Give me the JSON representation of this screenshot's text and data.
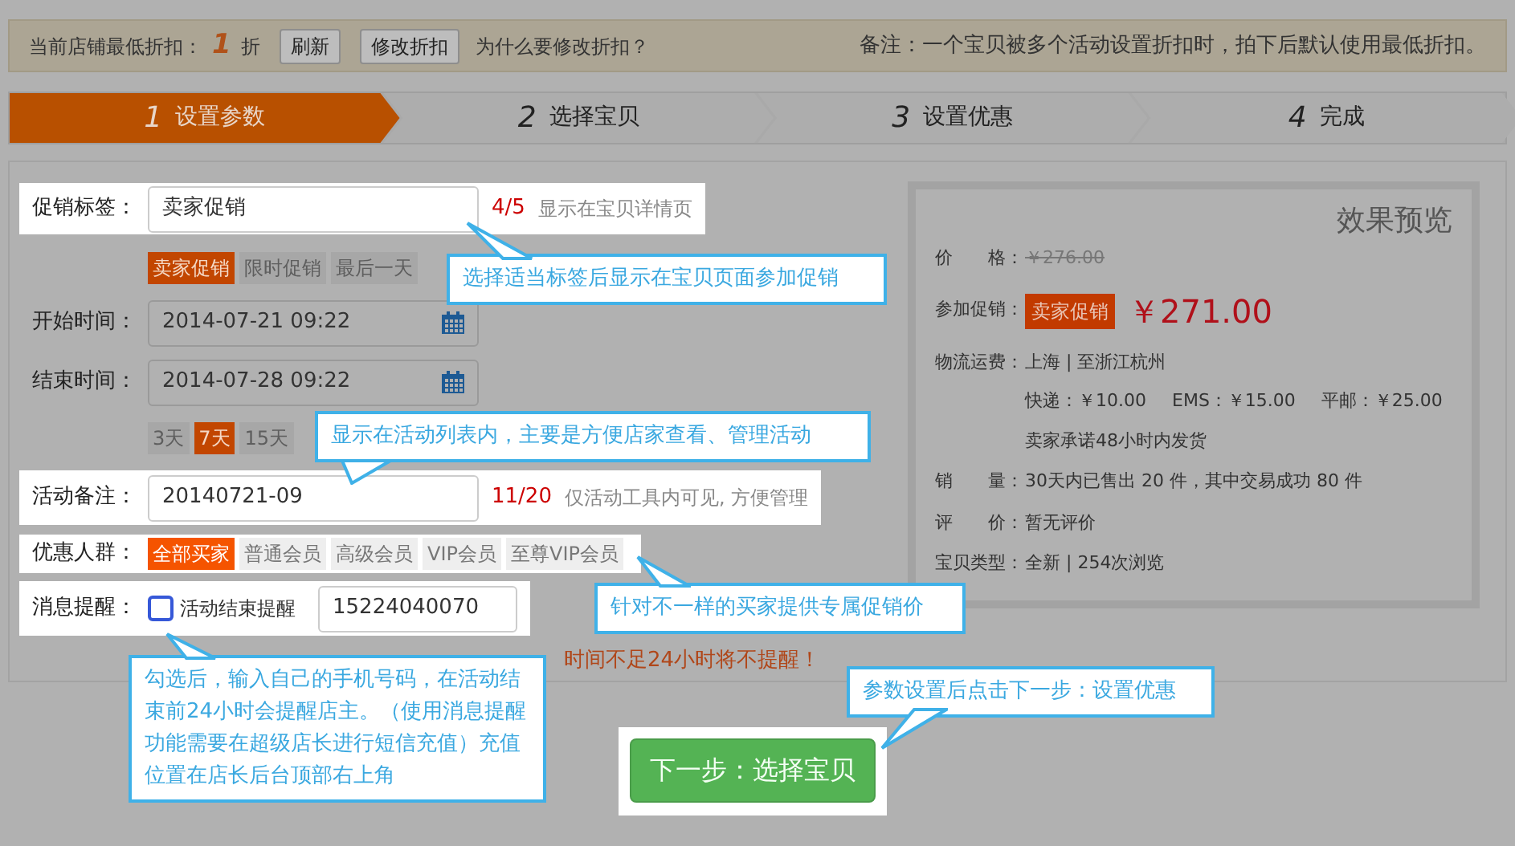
{
  "notice_bar": {
    "label": "当前店铺最低折扣：",
    "discount": "1",
    "unit": "折",
    "buttons": [
      "刷新",
      "修改折扣"
    ],
    "link": "为什么要修改折扣？",
    "note": "备注：一个宝贝被多个活动设置折扣时，拍下后默认使用最低折扣。"
  },
  "steps": [
    {
      "number": "1",
      "label": "设置参数",
      "selected": true
    },
    {
      "number": "2",
      "label": "选择宝贝",
      "selected": false
    },
    {
      "number": "3",
      "label": "设置优惠",
      "selected": false
    },
    {
      "number": "4",
      "label": "完成",
      "selected": false
    }
  ],
  "form": [
    {
      "kind": "text",
      "label": "促销标签：",
      "value": "卖家促销",
      "counter": "4/5",
      "hint": "显示在宝贝详情页",
      "highlighted": true
    },
    {
      "kind": "chips",
      "options": [
        {
          "label": "卖家促销",
          "selected": true
        },
        {
          "label": "限时促销",
          "selected": false
        },
        {
          "label": "最后一天",
          "selected": false
        }
      ],
      "highlighted": false
    },
    {
      "kind": "date",
      "label": "开始时间：",
      "value": "2014-07-21 09:22",
      "highlighted": false
    },
    {
      "kind": "date",
      "label": "结束时间：",
      "value": "2014-07-28 09:22",
      "highlighted": false
    },
    {
      "kind": "chips",
      "options": [
        {
          "label": "3天",
          "selected": false
        },
        {
          "label": "7天",
          "selected": true
        },
        {
          "label": "15天",
          "selected": false
        }
      ],
      "highlighted": false
    },
    {
      "kind": "text",
      "label": "活动备注：",
      "value": "20140721-09",
      "counter": "11/20",
      "hint": "仅活动工具内可见, 方便管理",
      "highlighted": true
    },
    {
      "kind": "chips",
      "label": "优惠人群：",
      "options": [
        {
          "label": "全部买家",
          "selected": true
        },
        {
          "label": "普通会员",
          "selected": false
        },
        {
          "label": "高级会员",
          "selected": false
        },
        {
          "label": "VIP会员",
          "selected": false
        },
        {
          "label": "至尊VIP会员",
          "selected": false
        }
      ],
      "highlighted": true
    },
    {
      "kind": "reminder",
      "label": "消息提醒：",
      "checked": false,
      "option": "活动结束提醒",
      "value": "15224040070",
      "highlighted": true
    },
    {
      "kind": "warning",
      "text": "时间不足24小时将不提醒！"
    }
  ],
  "preview": {
    "title": "效果预览",
    "rows": [
      {
        "kind": "strike",
        "label": "价　　格：",
        "value": "￥276.00"
      },
      {
        "kind": "promo",
        "label": "参加促销：",
        "tag": "卖家促销",
        "price": "￥271.00"
      },
      {
        "kind": "shipping",
        "label": "物流运费：",
        "route": "上海 | 至浙江杭州",
        "fees": [
          "快递：￥10.00",
          "EMS：￥15.00",
          "平邮：￥25.00"
        ],
        "promise": "卖家承诺48小时内发货"
      },
      {
        "kind": "plain",
        "label": "销　　量：",
        "value": "30天内已售出 20 件，其中交易成功 80 件"
      },
      {
        "kind": "plain",
        "label": "评　　价：",
        "value": "暂无评价"
      },
      {
        "kind": "plain",
        "label": "宝贝类型：",
        "value": "全新 | 254次浏览"
      }
    ]
  },
  "next_button": {
    "label": "下一步：选择宝贝",
    "highlighted": true
  },
  "callouts": [
    {
      "text": "选择适当标签后显示在宝贝页面参加促销"
    },
    {
      "text": "显示在活动列表内，主要是方便店家查看、管理活动"
    },
    {
      "text": "针对不一样的买家提供专属促销价"
    },
    {
      "text": "勾选后，输入自己的手机号码，在活动结束前24小时会提醒店主。（使用消息提醒功能需要在超级店长进行短信充值）充值位置在店长后台顶部右上角"
    },
    {
      "text": "参数设置后点击下一步：设置优惠"
    }
  ]
}
